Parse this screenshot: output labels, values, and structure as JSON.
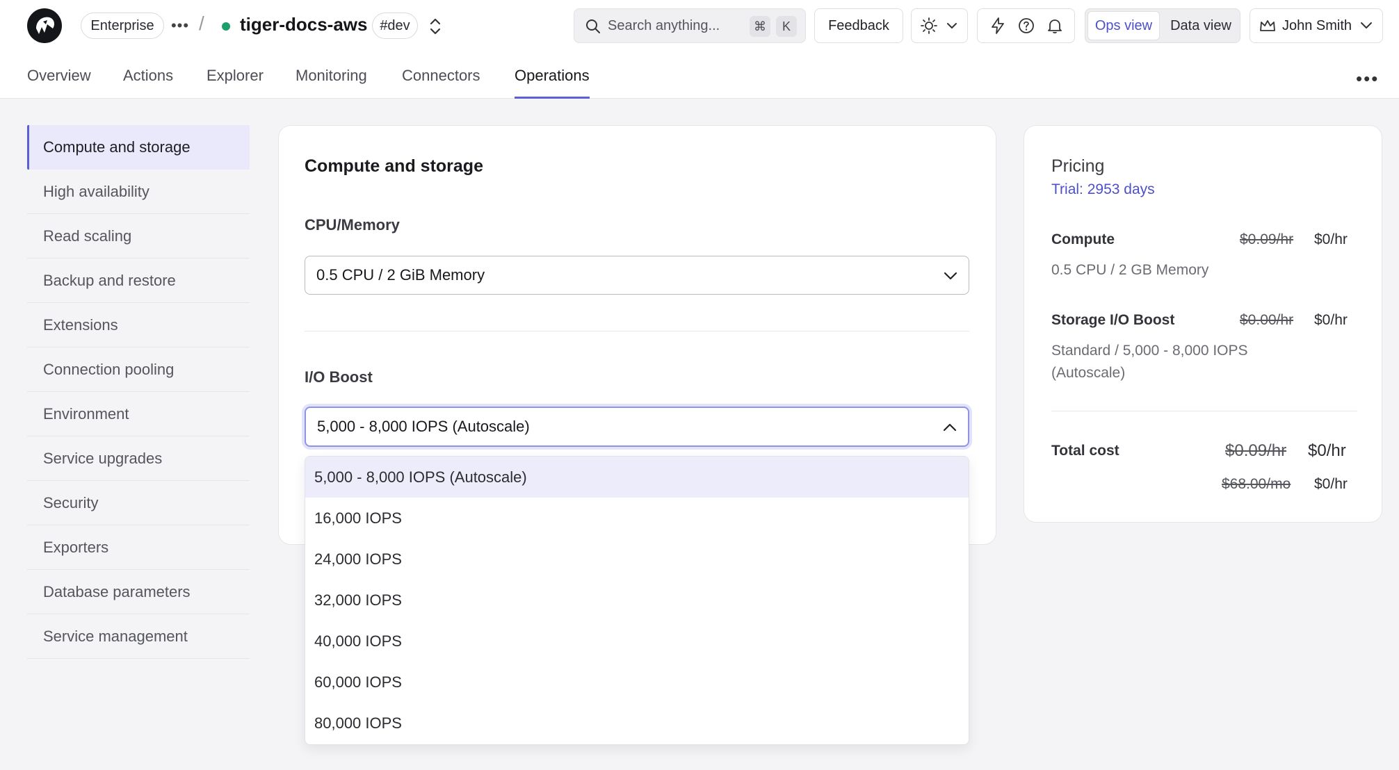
{
  "header": {
    "plan_badge": "Enterprise",
    "separator": "/",
    "project_name": "tiger-docs-aws",
    "env_badge": "#dev",
    "search_placeholder": "Search anything...",
    "search_shortcut_mod": "⌘",
    "search_shortcut_key": "K",
    "feedback_label": "Feedback",
    "ops_view_label": "Ops view",
    "data_view_label": "Data view",
    "user_name": "John Smith",
    "status_color": "#1f9d6b",
    "accent_color": "#5b5fd6"
  },
  "tabs": [
    "Overview",
    "Actions",
    "Explorer",
    "Monitoring",
    "Connectors",
    "Operations"
  ],
  "active_tab": "Operations",
  "sidebar": {
    "items": [
      "Compute and storage",
      "High availability",
      "Read scaling",
      "Backup and restore",
      "Extensions",
      "Connection pooling",
      "Environment",
      "Service upgrades",
      "Security",
      "Exporters",
      "Database parameters",
      "Service management"
    ],
    "active": "Compute and storage"
  },
  "main": {
    "title": "Compute and storage",
    "cpu_label": "CPU/Memory",
    "cpu_value": "0.5 CPU / 2 GiB Memory",
    "io_label": "I/O Boost",
    "io_value": "5,000 - 8,000 IOPS (Autoscale)",
    "io_options": [
      "5,000 - 8,000 IOPS (Autoscale)",
      "16,000 IOPS",
      "24,000 IOPS",
      "32,000 IOPS",
      "40,000 IOPS",
      "60,000 IOPS",
      "80,000 IOPS"
    ]
  },
  "pricing": {
    "title": "Pricing",
    "trial": "Trial: 2953 days",
    "compute_label": "Compute",
    "compute_old": "$0.09/hr",
    "compute_price": "$0/hr",
    "compute_desc": "0.5 CPU / 2 GB Memory",
    "storage_label": "Storage I/O Boost",
    "storage_old": "$0.00/hr",
    "storage_price": "$0/hr",
    "storage_desc": "Standard / 5,000 - 8,000 IOPS (Autoscale)",
    "total_label": "Total cost",
    "total_old_hr": "$0.09/hr",
    "total_hr": "$0/hr",
    "total_old_mo": "$68.00/mo",
    "total_mo": "$0/hr"
  }
}
